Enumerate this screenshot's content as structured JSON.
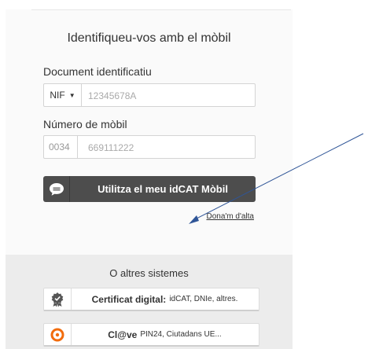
{
  "login": {
    "title": "Identifiqueu-vos amb el mòbil",
    "document_label": "Document identificatiu",
    "doc_type_selected": "NIF",
    "document_placeholder": "12345678A",
    "phone_label": "Número de mòbil",
    "country_code": "0034",
    "phone_placeholder": "669111222",
    "idcat_button": "Utilitza el meu idCAT Mòbil",
    "signup_link": "Dona'm d'alta"
  },
  "alternatives": {
    "title": "O altres sistemes",
    "certificate": {
      "name": "Certificat digital:",
      "detail": "idCAT, DNIe, altres."
    },
    "clave": {
      "name": "Cl@ve",
      "detail": "PIN24, Ciutadans UE..."
    }
  },
  "colors": {
    "button_dark": "#4d4d4d",
    "arrow": "#2f5597",
    "clave_orange": "#f26c0d"
  }
}
